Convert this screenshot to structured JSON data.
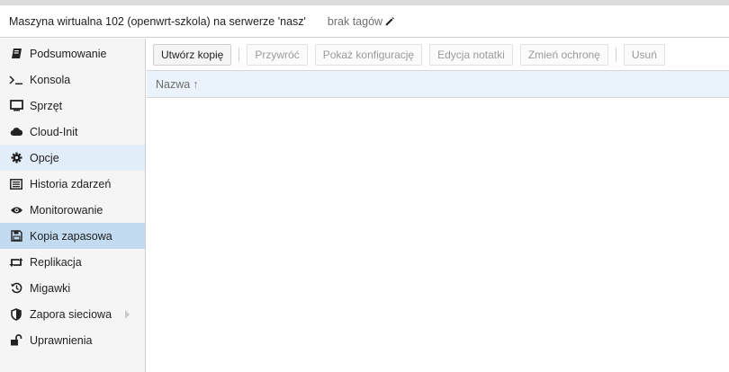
{
  "header": {
    "title": "Maszyna wirtualna 102 (openwrt-szkola) na serwerze 'nasz'",
    "tags": "brak tagów"
  },
  "sidebar": {
    "items": [
      {
        "label": "Podsumowanie",
        "icon": "book-icon"
      },
      {
        "label": "Konsola",
        "icon": "terminal-icon"
      },
      {
        "label": "Sprzęt",
        "icon": "monitor-icon"
      },
      {
        "label": "Cloud-Init",
        "icon": "cloud-icon"
      },
      {
        "label": "Opcje",
        "icon": "gear-icon",
        "state": "hover"
      },
      {
        "label": "Historia zdarzeń",
        "icon": "list-icon"
      },
      {
        "label": "Monitorowanie",
        "icon": "eye-icon"
      },
      {
        "label": "Kopia zapasowa",
        "icon": "floppy-icon",
        "state": "active"
      },
      {
        "label": "Replikacja",
        "icon": "retweet-icon"
      },
      {
        "label": "Migawki",
        "icon": "history-icon"
      },
      {
        "label": "Zapora sieciowa",
        "icon": "shield-icon"
      },
      {
        "label": "Uprawnienia",
        "icon": "unlock-icon"
      }
    ]
  },
  "toolbar": {
    "create_backup": "Utwórz kopię",
    "restore": "Przywróć",
    "show_config": "Pokaż konfigurację",
    "edit_notes": "Edycja notatki",
    "change_protection": "Zmień ochronę",
    "remove": "Usuń"
  },
  "grid": {
    "columns": [
      {
        "label": "Nazwa",
        "sort": "ascending"
      }
    ],
    "rows": []
  },
  "colors": {
    "sidebar_active": "#c3dbf1",
    "sidebar_hover": "#e1edf9",
    "grid_header": "#eaf3fb"
  }
}
